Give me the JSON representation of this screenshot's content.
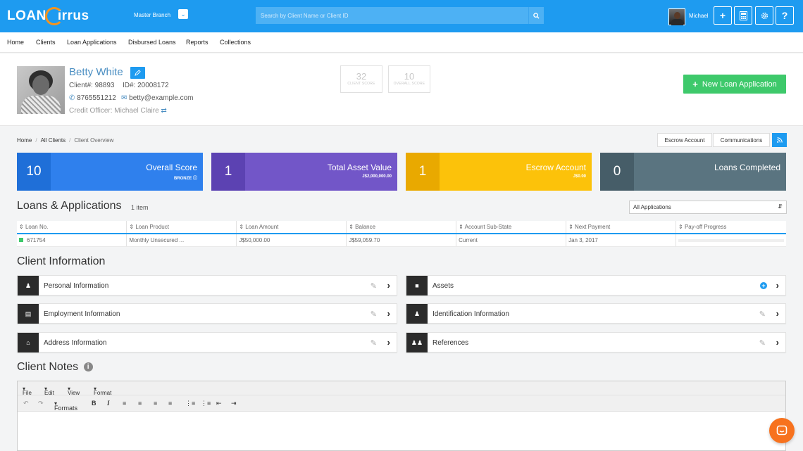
{
  "brand": {
    "name_left": "LOAN",
    "name_right": "irrus"
  },
  "header": {
    "branch": "Master Branch",
    "search_placeholder": "Search by Client Name or Client ID",
    "user_name": "Michael"
  },
  "nav": {
    "items": [
      "Home",
      "Clients",
      "Loan Applications",
      "Disbursed Loans",
      "Reports",
      "Collections"
    ]
  },
  "client": {
    "name": "Betty White",
    "client_no": "Client#: 98893",
    "id_no": "ID#: 20008172",
    "phone": "8765551212",
    "email": "betty@example.com",
    "credit_officer": "Credit Officer: Michael Claire",
    "client_score_value": "32",
    "client_score_label": "CLIENT SCORE",
    "overall_score_value": "10",
    "overall_score_label": "OVERALL SCORE",
    "new_loan_label": "New Loan Application"
  },
  "breadcrumb": {
    "items": [
      "Home",
      "All Clients"
    ],
    "current": "Client Overview"
  },
  "header_buttons": {
    "escrow": "Escrow Account",
    "communications": "Communications"
  },
  "stats": [
    {
      "num": "10",
      "title": "Overall Score",
      "sub": "BRONZE",
      "color": "#2f80ed",
      "dark": "#1f6fd8"
    },
    {
      "num": "1",
      "title": "Total Asset Value",
      "sub": "J$2,000,000.00",
      "color": "#7256c8",
      "dark": "#5c42b2"
    },
    {
      "num": "1",
      "title": "Escrow Account",
      "sub": "J$0.00",
      "color": "#fcc20a",
      "dark": "#e9a900"
    },
    {
      "num": "0",
      "title": "Loans Completed",
      "sub": "",
      "color": "#5a7480",
      "dark": "#465d68"
    }
  ],
  "loans": {
    "title": "Loans & Applications",
    "count": "1 item",
    "filter": "All Applications",
    "columns": [
      "Loan No.",
      "Loan Product",
      "Loan Amount",
      "Balance",
      "Account Sub-State",
      "Next Payment",
      "Pay-off Progress"
    ],
    "rows": [
      {
        "loan_no": "671754",
        "product": "Monthly Unsecured ...",
        "amount": "J$50,000.00",
        "balance": "J$59,059.70",
        "sub_state": "Current",
        "next_payment": "Jan 3, 2017",
        "progress": 0
      }
    ]
  },
  "client_info": {
    "title": "Client Information",
    "left": [
      "Personal Information",
      "Employment Information",
      "Address Information"
    ],
    "right": [
      "Assets",
      "Identification Information",
      "References"
    ]
  },
  "notes": {
    "title": "Client Notes",
    "menu": [
      "File",
      "Edit",
      "View",
      "Format"
    ],
    "formats_label": "Formats"
  }
}
